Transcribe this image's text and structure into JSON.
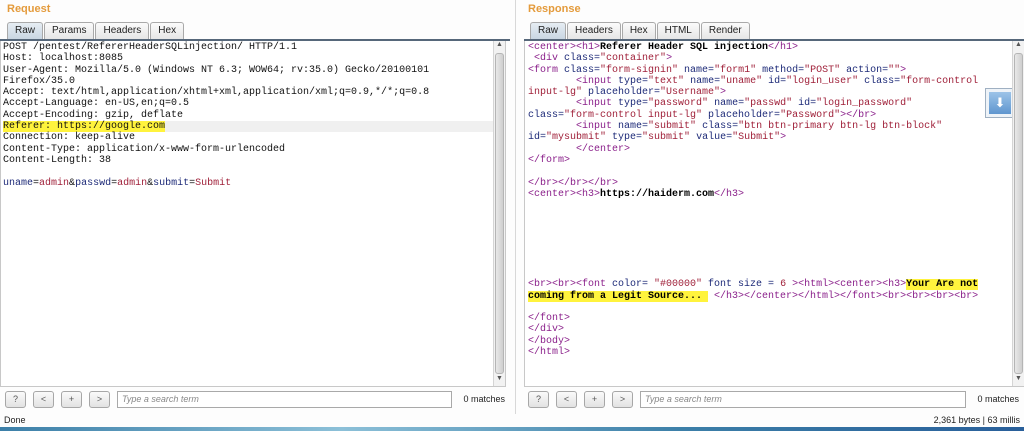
{
  "request": {
    "title": "Request",
    "tabs": [
      "Raw",
      "Params",
      "Headers",
      "Hex"
    ],
    "lines": [
      "POST /pentest/RefererHeaderSQLinjection/ HTTP/1.1",
      "Host: localhost:8085",
      "User-Agent: Mozilla/5.0 (Windows NT 6.3; WOW64; rv:35.0) Gecko/20100101",
      "Firefox/35.0",
      "Accept: text/html,application/xhtml+xml,application/xml;q=0.9,*/*;q=0.8",
      "Accept-Language: en-US,en;q=0.5",
      "Accept-Encoding: gzip, deflate",
      "Referer: https://google.com",
      "Connection: keep-alive",
      "Content-Type: application/x-www-form-urlencoded",
      "Content-Length: 38",
      ""
    ],
    "body": [
      [
        "pn",
        "uname"
      ],
      [
        "p",
        "="
      ],
      [
        "pv",
        "admin"
      ],
      [
        "p",
        "&"
      ],
      [
        "pn",
        "passwd"
      ],
      [
        "p",
        "="
      ],
      [
        "pv",
        "admin"
      ],
      [
        "p",
        "&"
      ],
      [
        "pn",
        "submit"
      ],
      [
        "p",
        "="
      ],
      [
        "pv",
        "Submit"
      ]
    ],
    "search_placeholder": "Type a search term",
    "matches": "0 matches",
    "buttons": [
      "?",
      "<",
      "+",
      ">"
    ]
  },
  "response": {
    "title": "Response",
    "tabs": [
      "Raw",
      "Headers",
      "Hex",
      "HTML",
      "Render"
    ],
    "lines": [
      [
        [
          "tag",
          "<center><h1>"
        ],
        [
          "b",
          "Referer Header SQL injection"
        ],
        [
          "tag",
          "</h1>"
        ]
      ],
      [
        [
          "p",
          " "
        ],
        [
          "tag",
          "<div "
        ],
        [
          "attr",
          "class="
        ],
        [
          "val",
          "\"container\""
        ],
        [
          "tag",
          ">"
        ]
      ],
      [
        [
          "tag",
          "<form "
        ],
        [
          "attr",
          "class="
        ],
        [
          "val",
          "\"form-signin\""
        ],
        [
          "attr",
          " name="
        ],
        [
          "val",
          "\"form1\""
        ],
        [
          "attr",
          " method="
        ],
        [
          "val",
          "\"POST\""
        ],
        [
          "attr",
          " action="
        ],
        [
          "val",
          "\"\""
        ],
        [
          "tag",
          ">"
        ]
      ],
      [
        [
          "p",
          "        "
        ],
        [
          "tag",
          "<input "
        ],
        [
          "attr",
          "type="
        ],
        [
          "val",
          "\"text\""
        ],
        [
          "attr",
          " name="
        ],
        [
          "val",
          "\"uname\""
        ],
        [
          "attr",
          " id="
        ],
        [
          "val",
          "\"login_user\""
        ],
        [
          "attr",
          " class="
        ],
        [
          "val",
          "\"form-control"
        ]
      ],
      [
        [
          "val",
          "input-lg\""
        ],
        [
          "attr",
          " placeholder="
        ],
        [
          "val",
          "\"Username\""
        ],
        [
          "tag",
          ">"
        ]
      ],
      [
        [
          "p",
          "        "
        ],
        [
          "tag",
          "<input "
        ],
        [
          "attr",
          "type="
        ],
        [
          "val",
          "\"password\""
        ],
        [
          "attr",
          " name="
        ],
        [
          "val",
          "\"passwd\""
        ],
        [
          "attr",
          " id="
        ],
        [
          "val",
          "\"login_password\""
        ]
      ],
      [
        [
          "attr",
          "class="
        ],
        [
          "val",
          "\"form-control input-lg\""
        ],
        [
          "attr",
          " placeholder="
        ],
        [
          "val",
          "\"Password\""
        ],
        [
          "tag",
          "></br>"
        ]
      ],
      [
        [
          "p",
          "        "
        ],
        [
          "tag",
          "<input "
        ],
        [
          "attr",
          "name="
        ],
        [
          "val",
          "\"submit\""
        ],
        [
          "attr",
          " class="
        ],
        [
          "val",
          "\"btn btn-primary btn-lg btn-block\""
        ]
      ],
      [
        [
          "attr",
          "id="
        ],
        [
          "val",
          "\"mysubmit\""
        ],
        [
          "attr",
          " type="
        ],
        [
          "val",
          "\"submit\""
        ],
        [
          "attr",
          " value="
        ],
        [
          "val",
          "\"Submit\""
        ],
        [
          "tag",
          ">"
        ]
      ],
      [
        [
          "p",
          "        "
        ],
        [
          "tag",
          "</center>"
        ]
      ],
      [
        [
          "tag",
          "</form>"
        ]
      ],
      [],
      [
        [
          "tag",
          "</br></br></br>"
        ]
      ],
      [
        [
          "tag",
          "<center><h3>"
        ],
        [
          "b",
          "https://haiderm.com"
        ],
        [
          "tag",
          "</h3>"
        ]
      ],
      [],
      [],
      [],
      [],
      [],
      [],
      [],
      [
        [
          "tag",
          "<br><br><font "
        ],
        [
          "attr",
          "color= "
        ],
        [
          "val",
          "\"#00000\""
        ],
        [
          "attr",
          " font size = "
        ],
        [
          "val",
          "6"
        ],
        [
          "tag",
          " ><html><center><h3>"
        ],
        [
          "b hl",
          "Your Are not"
        ]
      ],
      [
        [
          "b hl",
          "coming from a Legit Source... "
        ],
        [
          "tag",
          " </h3></center></html></font><br><br><br><br>"
        ]
      ],
      [],
      [
        [
          "tag",
          "</font>"
        ]
      ],
      [
        [
          "tag",
          "</div>"
        ]
      ],
      [
        [
          "tag",
          "</body>"
        ]
      ],
      [
        [
          "tag",
          "</html>"
        ]
      ]
    ],
    "search_placeholder": "Type a search term",
    "matches": "0 matches",
    "buttons": [
      "?",
      "<",
      "+",
      ">"
    ]
  },
  "status": {
    "left": "Done",
    "right": "2,361 bytes | 63 millis"
  }
}
